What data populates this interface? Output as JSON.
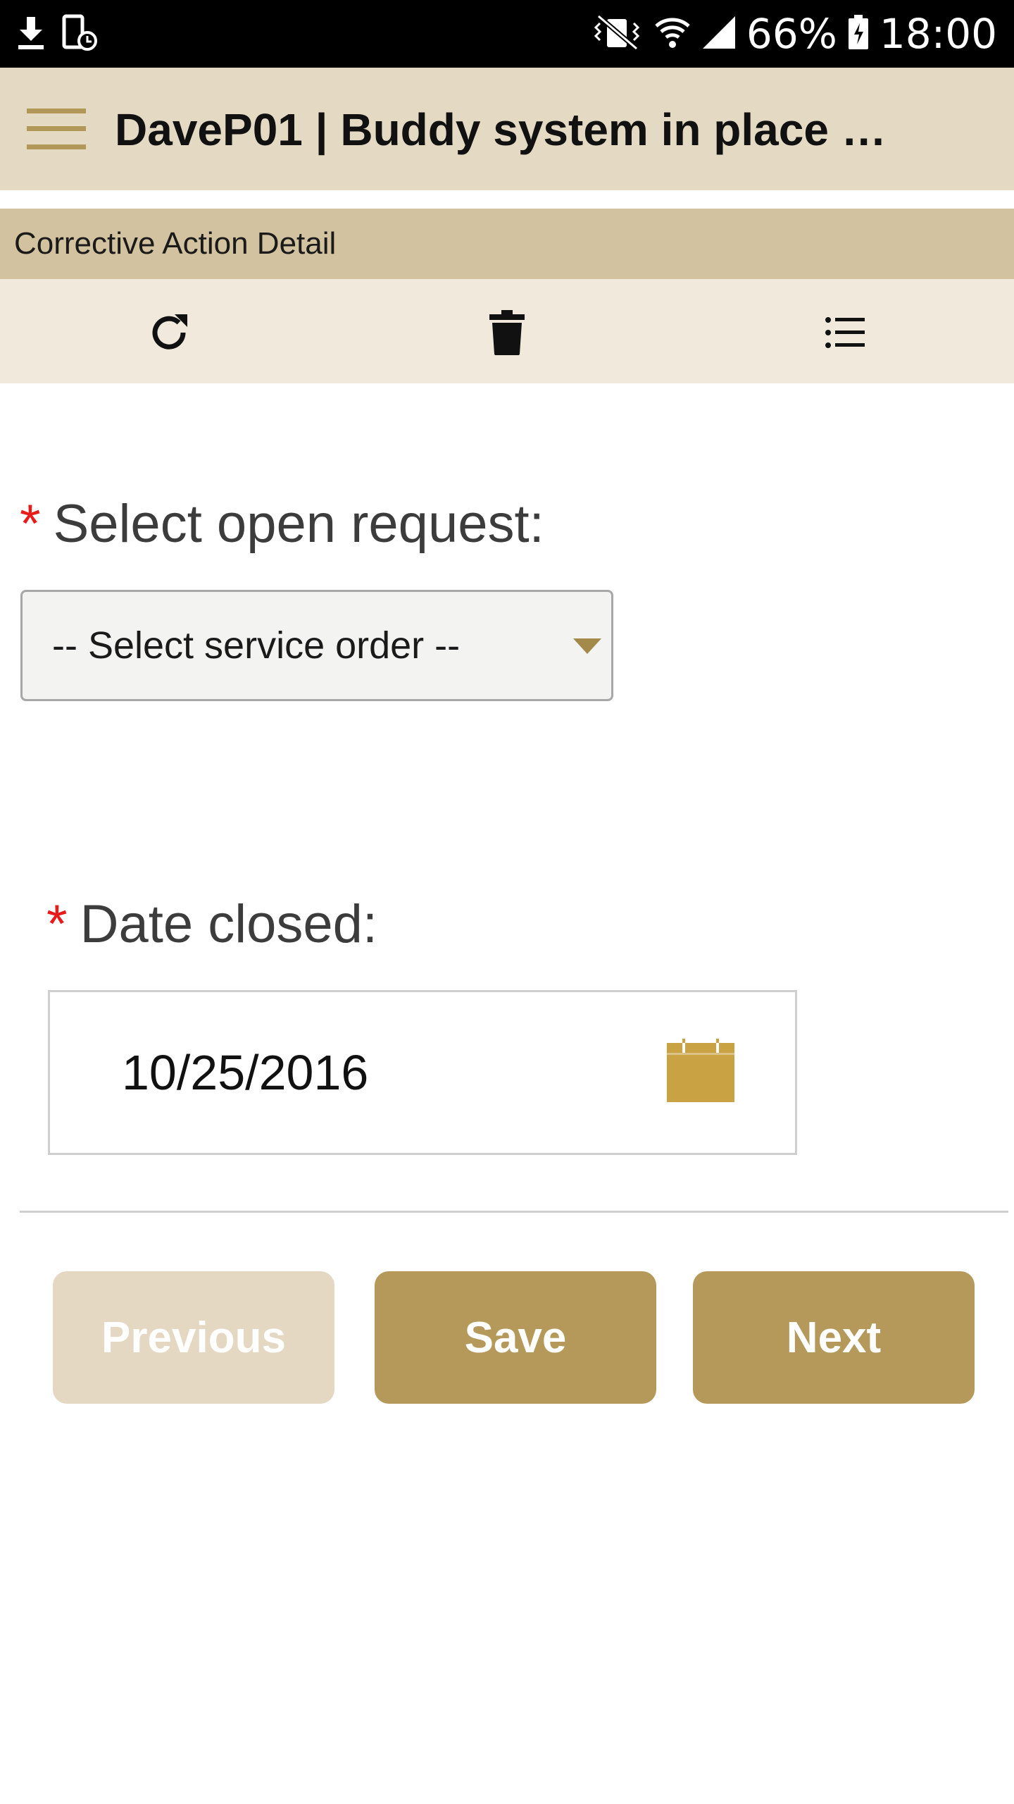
{
  "status_bar": {
    "battery": "66%",
    "time": "18:00"
  },
  "header": {
    "title": "DaveP01 | Buddy system in place a..."
  },
  "section": {
    "title": "Corrective Action Detail"
  },
  "toolbar": {
    "icons": [
      "refresh-icon",
      "trash-icon",
      "list-icon"
    ]
  },
  "form": {
    "open_request": {
      "required_marker": "*",
      "label": "Select open request:",
      "selected_value": "-- Select service order --"
    },
    "date_closed": {
      "required_marker": "*",
      "label": "Date closed:",
      "value": "10/25/2016"
    }
  },
  "buttons": {
    "previous": "Previous",
    "save": "Save",
    "next": "Next"
  },
  "colors": {
    "accent": "#b4995a",
    "header_bg": "#e4d9c3",
    "section_bg": "#d3c29f",
    "toolbar_bg": "#f0e9dc",
    "calendar": "#c9a244",
    "required": "#e81b1b"
  }
}
